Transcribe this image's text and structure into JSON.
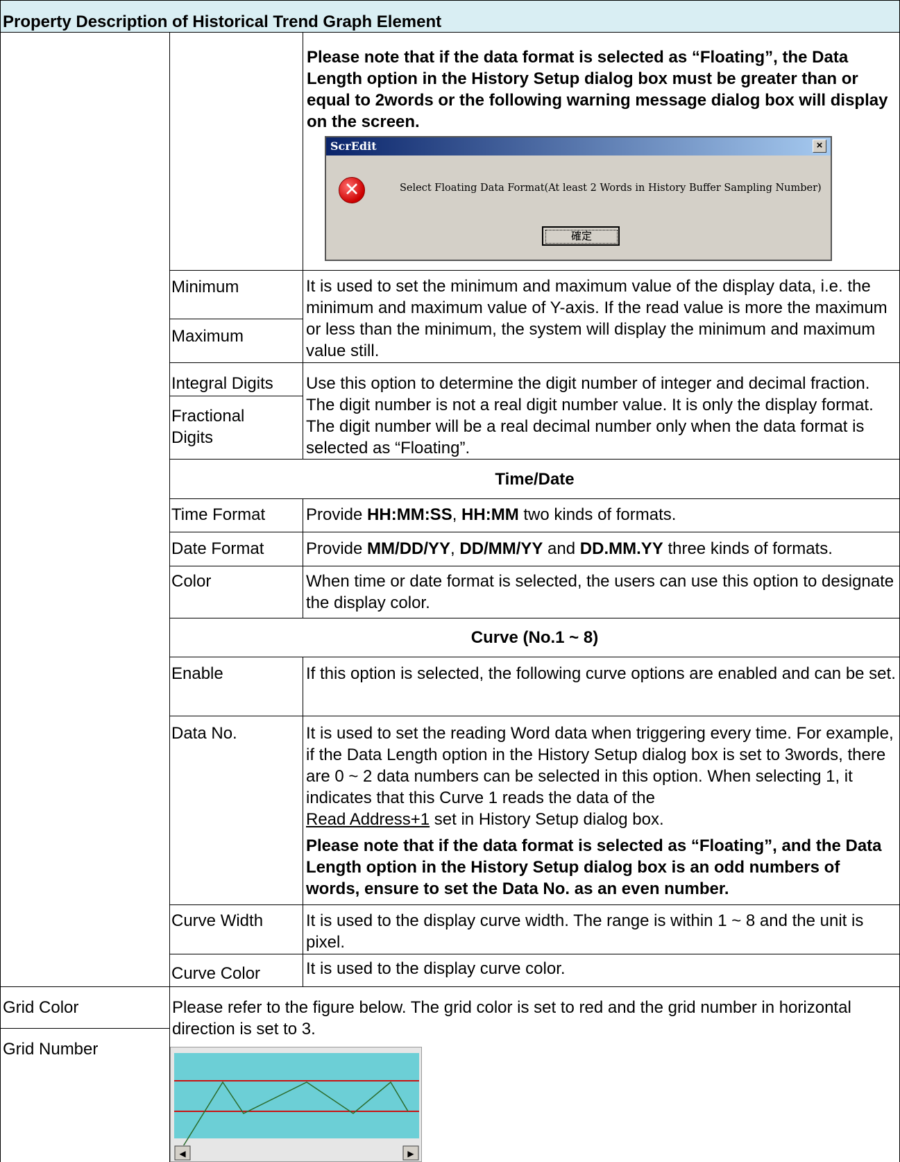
{
  "header": {
    "title": "Property Description of Historical Trend Graph Element"
  },
  "floating_note": "Please note that if the data format is selected as “Floating”, the Data Length option in the History Setup dialog box must be greater than or equal to 2words or the following warning message dialog box will display on the screen.",
  "dialog": {
    "title": "ScrEdit",
    "close": "×",
    "message": "Select Floating Data Format(At least 2 Words in History Buffer Sampling Number)",
    "ok_label": "確定",
    "icon": "error-icon"
  },
  "rows": {
    "minimum": "Minimum",
    "maximum": "Maximum",
    "minmax_desc": "It is used to set the minimum and maximum value of the display data, i.e. the minimum and maximum value of Y-axis. If the read value is more the maximum or less than the minimum, the system will display the minimum and maximum value still.",
    "integral_digits": "Integral Digits",
    "fractional_digits": "Fractional Digits",
    "digits_desc": "Use this option to determine the digit number of integer and decimal fraction. The digit number is not a real digit number value. It is only the display format. The digit number will be a real decimal number only when the data format is selected as “Floating”.",
    "time_date_section": "Time/Date",
    "time_format": "Time Format",
    "time_format_desc": {
      "pre": "Provide ",
      "f1": "HH:MM:SS",
      "sep": ", ",
      "f2": "HH:MM",
      "post": " two kinds of formats."
    },
    "date_format": "Date Format",
    "date_format_desc": {
      "pre": "Provide ",
      "f1": "MM/DD/YY",
      "sep1": ", ",
      "f2": "DD/MM/YY",
      "sep2": " and ",
      "f3": "DD.MM.YY",
      "post": " three kinds of formats."
    },
    "color": "Color",
    "color_desc": "When time or date format is selected, the users can use this option to designate the display color.",
    "curve_section": "Curve (No.1 ~ 8)",
    "enable": "Enable",
    "enable_desc": "If this option is selected, the following curve options are enabled and can be set.",
    "data_no": "Data No.",
    "data_no_desc": "It is used to set the reading Word data when triggering every time. For example, if the Data Length option in the History Setup dialog box is set to 3words, there are 0 ~ 2 data numbers can be selected in this option. When selecting 1, it indicates that this Curve 1 reads the data of the",
    "data_no_link": "Read Address+1",
    "data_no_tail": " set in History Setup dialog box.",
    "data_no_note": "Please note that if the data format is selected as “Floating”, and the Data Length option in the History Setup dialog box is an odd numbers of words, ensure to set the Data No. as an even number.",
    "curve_width": "Curve Width",
    "curve_width_desc": "It is used to the display curve width. The range is within 1 ~ 8 and the unit is pixel.",
    "curve_color": "Curve Color",
    "curve_color_desc": "It is used to the display curve color.",
    "grid_color": "Grid Color",
    "grid_number": "Grid Number",
    "grid_desc": "Please refer to the figure below. The grid color is set to red and the grid number in horizontal direction is set to 3.",
    "scroll_left": "◀",
    "scroll_right": "▶"
  },
  "figure": {
    "background_color": "#6ccfd6",
    "grid_color": "#cc1111",
    "curve_color": "#2b6b2b",
    "horizontal_grid_number": 3
  },
  "colors": {
    "header_background": "#d9eef3"
  }
}
